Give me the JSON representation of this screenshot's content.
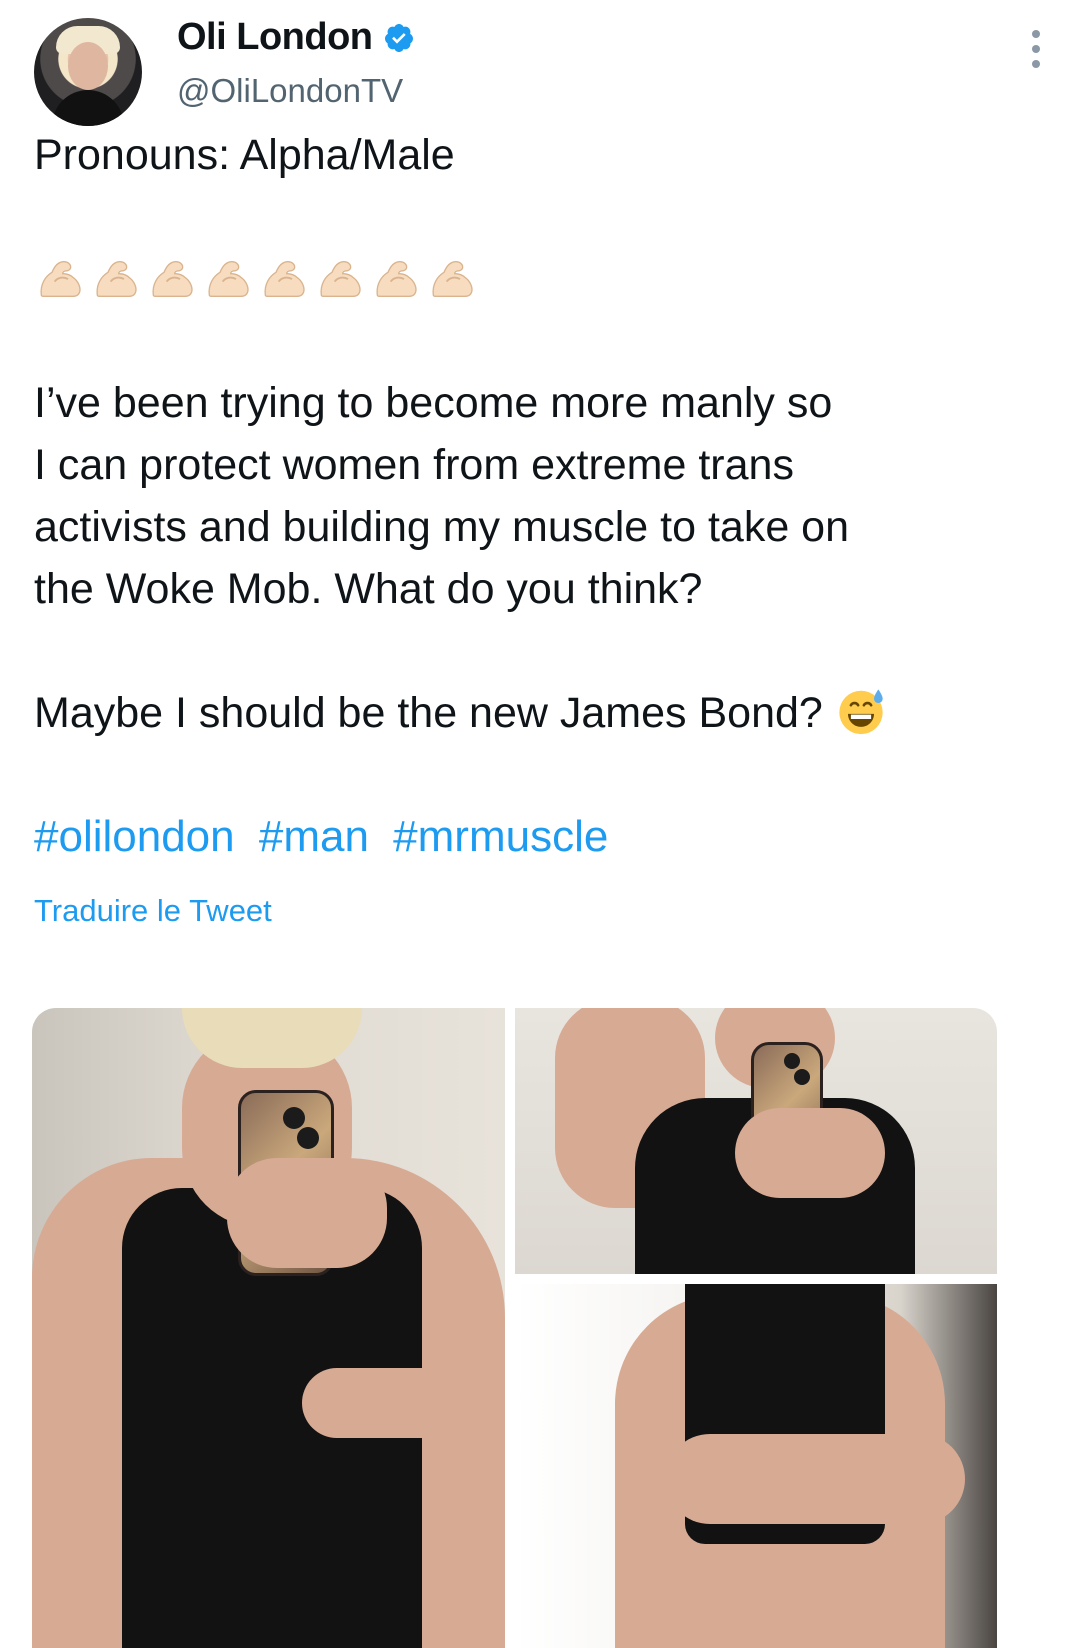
{
  "author": {
    "name": "Oli London",
    "handle": "@OliLondonTV",
    "verified": true,
    "verified_color": "#1d9bf0"
  },
  "tweet": {
    "pronouns_line": "Pronouns: Alpha/Male",
    "emoji_row": [
      "flexed-biceps",
      "flexed-biceps",
      "flexed-biceps",
      "flexed-biceps",
      "flexed-biceps",
      "flexed-biceps",
      "flexed-biceps",
      "flexed-biceps"
    ],
    "body_lines": [
      "I’ve been trying to become more manly so",
      "I can protect women from extreme trans",
      "activists and building my muscle to take on",
      "the Woke Mob. What do you think?"
    ],
    "bond_line": "Maybe I should be the new James Bond?",
    "bond_emoji": "grinning-face-with-sweat",
    "hashtags": [
      "#olilondon",
      "#man",
      "#mrmuscle"
    ],
    "translate_label": "Traduire le Tweet",
    "link_color": "#1d9bf0"
  },
  "media": {
    "count": 3,
    "photos": [
      "mirror-selfie-flexing-arm",
      "mirror-selfie-arm-raised",
      "crossed-arms-tank-top"
    ]
  },
  "icons": {
    "more": "more-vertical-icon",
    "verified": "verified-badge-icon"
  }
}
